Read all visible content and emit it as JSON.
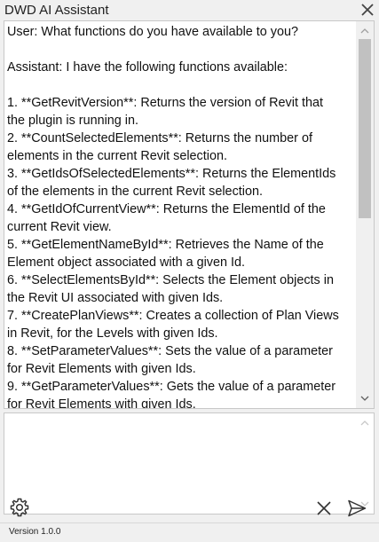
{
  "window": {
    "title": "DWD AI Assistant",
    "close_icon": "close-icon"
  },
  "chat": {
    "lines": [
      "User: What functions do you have available to you?",
      "",
      "Assistant: I have the following functions available:",
      "",
      "1. **GetRevitVersion**: Returns the version of Revit that",
      "the plugin is running in.",
      "2. **CountSelectedElements**: Returns the number of",
      "elements in the current Revit selection.",
      "3. **GetIdsOfSelectedElements**: Returns the ElementIds",
      "of the elements in the current Revit selection.",
      "4. **GetIdOfCurrentView**: Returns the ElementId of the",
      "current Revit view.",
      "5. **GetElementNameById**: Retrieves the Name of the",
      "Element object associated with a given Id.",
      "6. **SelectElementsById**: Selects the Element objects in",
      "the Revit UI associated with given Ids.",
      "7. **CreatePlanViews**: Creates a collection of Plan Views",
      "in Revit, for the Levels with given Ids.",
      "8. **SetParameterValues**: Sets the value of a parameter",
      "for Revit Elements with given Ids.",
      "9. **GetParameterValues**: Gets the value of a parameter",
      "for Revit Elements with given Ids."
    ]
  },
  "input": {
    "value": ""
  },
  "toolbar": {
    "settings_icon": "gear-icon",
    "clear_icon": "close-icon",
    "send_icon": "send-icon"
  },
  "status": {
    "version": "Version 1.0.0"
  }
}
